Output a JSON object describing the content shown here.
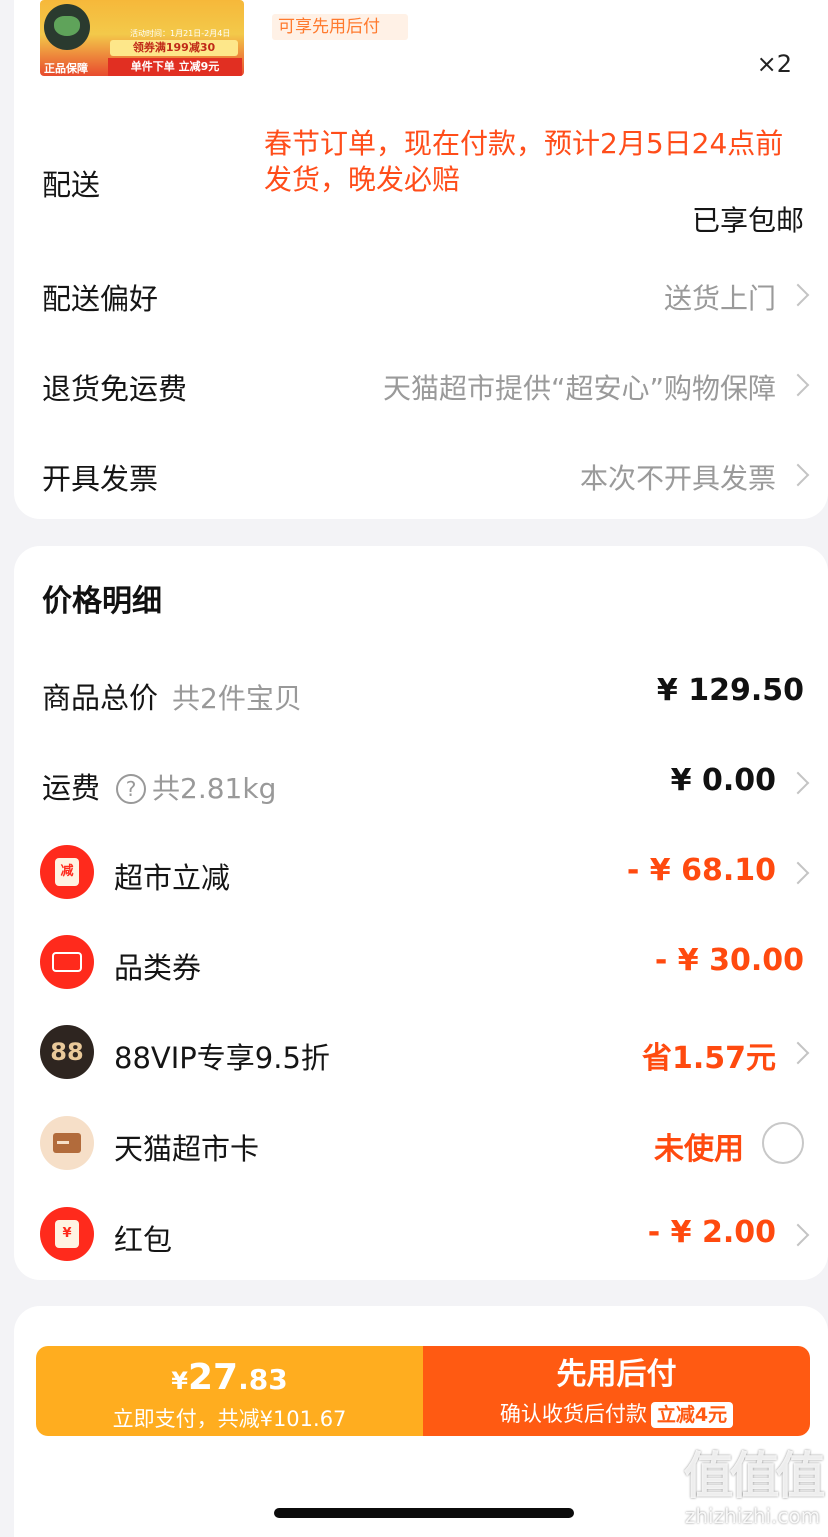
{
  "product": {
    "thumb_date": "活动时间：1月21日-2月4日",
    "thumb_coupon": "领券满199减30",
    "thumb_guarantee": "正品保障",
    "thumb_discount": "单件下单 立减9元",
    "pay_later_tag": "可享先用后付",
    "quantity": "×2"
  },
  "delivery": {
    "label": "配送",
    "notice": "春节订单，现在付款，预计2月5日24点前发货，晚发必赔",
    "free_shipping": "已享包邮"
  },
  "settings": [
    {
      "label": "配送偏好",
      "value": "送货上门"
    },
    {
      "label": "退货免运费",
      "value": "天猫超市提供“超安心”购物保障"
    },
    {
      "label": "开具发票",
      "value": "本次不开具发票"
    }
  ],
  "price_detail": {
    "title": "价格明细",
    "subtotal": {
      "label": "商品总价",
      "sub": "共2件宝贝",
      "value": "¥ 129.50"
    },
    "shipping": {
      "label": "运费",
      "sub": "共2.81kg",
      "value": "¥ 0.00"
    },
    "discounts": [
      {
        "label": "超市立减",
        "value": "- ¥ 68.10",
        "icon": "reduction-icon",
        "icon_text": "减"
      },
      {
        "label": "品类券",
        "value": "- ¥ 30.00",
        "icon": "coupon-icon"
      },
      {
        "label": "88VIP专享9.5折",
        "value": "省1.57元",
        "icon": "vip-88-icon",
        "icon_text": "88"
      },
      {
        "label": "天猫超市卡",
        "value": "未使用",
        "icon": "card-icon"
      },
      {
        "label": "红包",
        "value": "- ¥ 2.00",
        "icon": "red-envelope-icon",
        "icon_text": "¥"
      }
    ]
  },
  "pay_bar": {
    "currency": "¥",
    "amount_int": "27",
    "amount_dec": ".83",
    "pay_now_sub": "立即支付，共减¥101.67",
    "pay_later_title": "先用后付",
    "pay_later_sub": "确认收货后付款",
    "pay_later_badge": "立减4元"
  },
  "watermark": {
    "big": "值值值",
    "small": "zhizhizhi.com"
  },
  "colors": {
    "accent_red": "#ff4a0f",
    "pay_now": "#ffad1f",
    "pay_later": "#ff5a12"
  }
}
